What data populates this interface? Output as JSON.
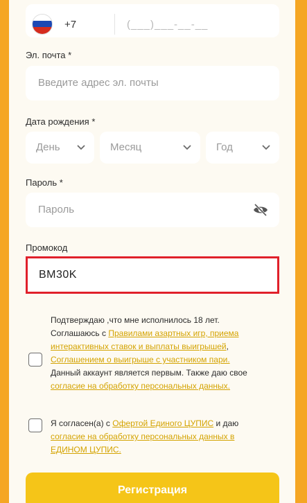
{
  "phone": {
    "code": "+7",
    "mask": "(___)___-__-__"
  },
  "email": {
    "label": "Эл. почта *",
    "placeholder": "Введите адрес эл. почты"
  },
  "birth": {
    "label": "Дата рождения *",
    "day": "День",
    "month": "Месяц",
    "year": "Год"
  },
  "password": {
    "label": "Пароль *",
    "placeholder": "Пароль"
  },
  "promo": {
    "label": "Промокод",
    "value": "BM30K"
  },
  "consent1": {
    "t1": "Подтверждаю ,что мне исполнилось 18 лет. Соглашаюсь с ",
    "link1": "Правилами азартных игр, приема интерактивных ставок и выплаты выигрышей",
    "t2": ", ",
    "link2": "Соглашением о выигрыше с участником пари.",
    "t3": " Данный аккаунт является первым. Также даю свое ",
    "link3": "согласие на обработку персональных данных."
  },
  "consent2": {
    "t1": "Я согласен(а) с ",
    "link1": "Офертой Единого ЦУПИС",
    "t2": " и даю ",
    "link2": "согласие на обработку персональных данных в ЕДИНОМ ЦУПИС."
  },
  "register_label": "Регистрация",
  "colors": {
    "accent": "#f5c518",
    "link": "#d4a300",
    "highlight": "#e0202a"
  }
}
